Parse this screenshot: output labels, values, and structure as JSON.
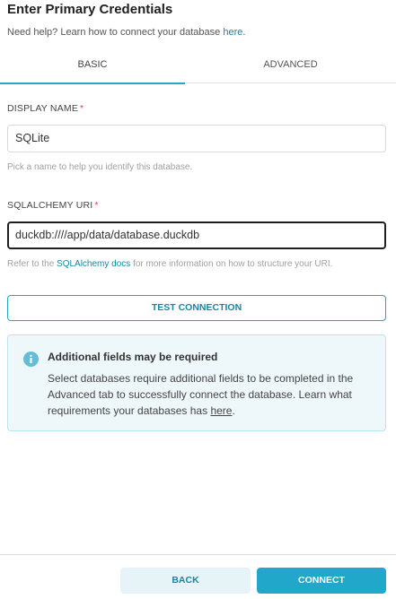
{
  "header": {
    "title": "Enter Primary Credentials",
    "help_prefix": "Need help? Learn how to connect your database ",
    "help_link": "here",
    "help_suffix": "."
  },
  "tabs": [
    {
      "label": "BASIC",
      "active": true
    },
    {
      "label": "ADVANCED",
      "active": false
    }
  ],
  "display_name": {
    "label": "DISPLAY NAME",
    "required_mark": "*",
    "value": "SQLite",
    "hint": "Pick a name to help you identify this database."
  },
  "sqlalchemy_uri": {
    "label": "SQLALCHEMY URI",
    "required_mark": "*",
    "value": "duckdb:////app/data/database.duckdb",
    "hint_prefix": "Refer to the ",
    "hint_link": "SQLAlchemy docs",
    "hint_suffix": " for more information on how to structure your URI."
  },
  "test_connection_label": "TEST CONNECTION",
  "alert": {
    "icon": "info-icon",
    "title": "Additional fields may be required",
    "body_prefix": "Select databases require additional fields to be completed in the Advanced tab to successfully connect the database. Learn what requirements your databases has ",
    "body_link": "here",
    "body_suffix": "."
  },
  "footer": {
    "back_label": "BACK",
    "connect_label": "CONNECT"
  },
  "colors": {
    "accent": "#20a7c9",
    "link": "#1a85a0",
    "required": "#e04355",
    "alert_bg": "#eef8fb",
    "alert_border": "#b7e6f2"
  }
}
